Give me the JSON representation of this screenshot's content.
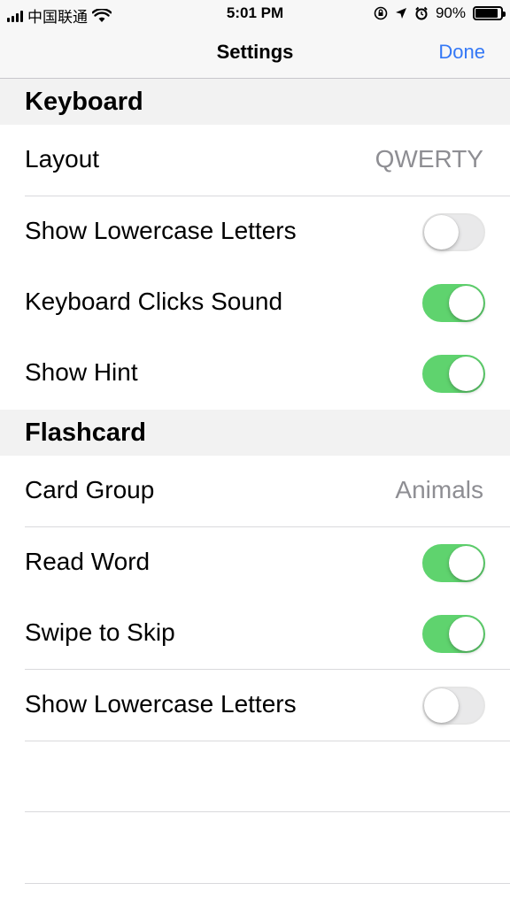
{
  "status_bar": {
    "carrier": "中国联通",
    "time": "5:01 PM",
    "battery_percent": "90%",
    "battery_level": 0.9,
    "icons": [
      "signal-icon",
      "wifi-icon",
      "rotation-lock-icon",
      "location-icon",
      "alarm-icon",
      "battery-icon"
    ]
  },
  "navbar": {
    "title": "Settings",
    "done_label": "Done"
  },
  "colors": {
    "accent": "#3478f6",
    "toggle_on": "#5fd36e",
    "toggle_off": "#e9e9ea",
    "secondary_text": "#8e8e93"
  },
  "sections": [
    {
      "title": "Keyboard",
      "rows": [
        {
          "label": "Layout",
          "value": "QWERTY"
        },
        {
          "label": "Show Lowercase Letters",
          "toggle": false
        },
        {
          "label": "Keyboard Clicks Sound",
          "toggle": true
        },
        {
          "label": "Show Hint",
          "toggle": true
        }
      ]
    },
    {
      "title": "Flashcard",
      "rows": [
        {
          "label": "Card Group",
          "value": "Animals"
        },
        {
          "label": "Read Word",
          "toggle": true
        },
        {
          "label": "Swipe to Skip",
          "toggle": true
        },
        {
          "label": "Show Lowercase Letters",
          "toggle": false
        }
      ]
    }
  ]
}
